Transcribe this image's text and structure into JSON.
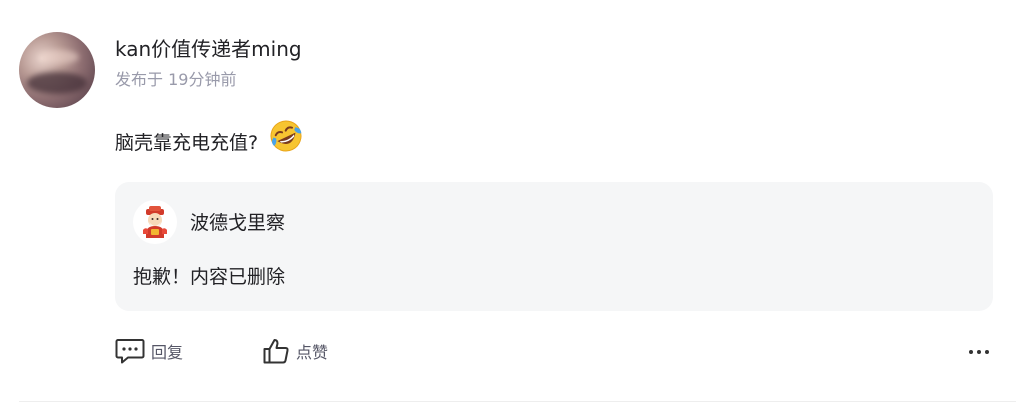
{
  "post": {
    "author": "kan价值传递者ming",
    "published": "发布于 19分钟前",
    "content": "脑壳靠充电充值?",
    "emoji": "rolling-on-floor-laughing-emoji"
  },
  "quote": {
    "author": "波德戈里察",
    "text": "抱歉！内容已删除"
  },
  "actions": {
    "reply_label": "回复",
    "like_label": "点赞"
  },
  "colors": {
    "text_primary": "#222226",
    "text_muted": "#999aaa",
    "card_bg": "#f5f6f7",
    "action_text": "#555666"
  }
}
